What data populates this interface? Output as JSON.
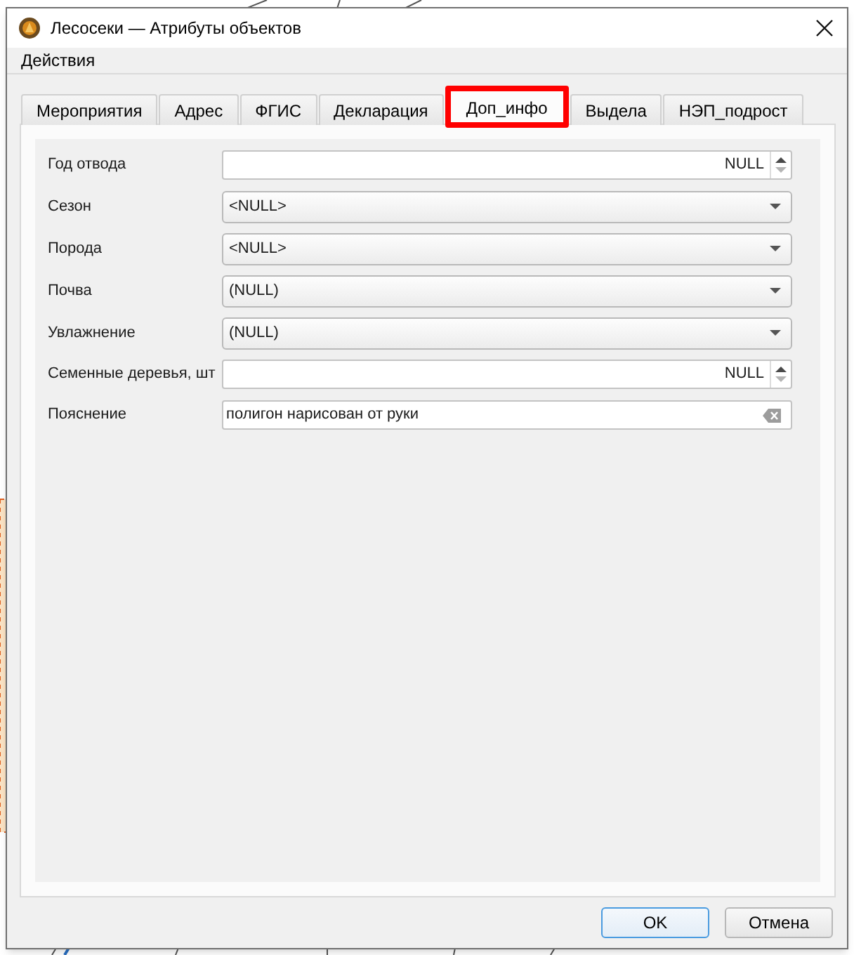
{
  "window": {
    "title": "Лесосеки — Атрибуты объектов"
  },
  "menu": [
    {
      "label": "Действия",
      "mnemonic": true
    }
  ],
  "tabs": [
    {
      "label": "Мероприятия",
      "selected": false,
      "highlighted": false
    },
    {
      "label": "Адрес",
      "selected": false,
      "highlighted": false
    },
    {
      "label": "ФГИС",
      "selected": false,
      "highlighted": false
    },
    {
      "label": "Декларация",
      "selected": false,
      "highlighted": false
    },
    {
      "label": "Доп_инфо",
      "selected": true,
      "highlighted": true
    },
    {
      "label": "Выдела",
      "selected": false,
      "highlighted": false
    },
    {
      "label": "НЭП_подрост",
      "selected": false,
      "highlighted": false
    }
  ],
  "fields": [
    {
      "label": "Год отвода",
      "kind": "spinbox",
      "value": "NULL"
    },
    {
      "label": "Сезон",
      "kind": "combobox",
      "value": "<NULL>"
    },
    {
      "label": "Порода",
      "kind": "combobox",
      "value": "<NULL>"
    },
    {
      "label": "Почва",
      "kind": "combobox",
      "value": "(NULL)"
    },
    {
      "label": "Увлажнение",
      "kind": "combobox",
      "value": "(NULL)"
    },
    {
      "label": "Семенные деревья, шт",
      "kind": "spinbox",
      "value": "NULL"
    },
    {
      "label": "Пояснение",
      "kind": "text",
      "value": "полигон нарисован от руки"
    }
  ],
  "buttons": [
    {
      "label": "OK",
      "default": true
    },
    {
      "label": "Отмена",
      "default": false
    }
  ]
}
